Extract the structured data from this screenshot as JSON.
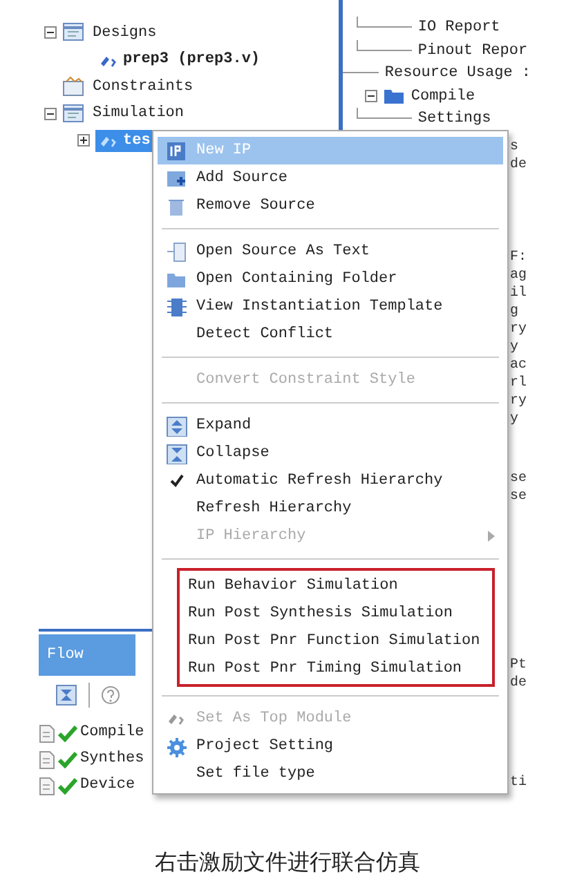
{
  "left_tree": [
    {
      "label": "Designs",
      "expandable": true,
      "expanded": true,
      "children": [
        {
          "label": "prep3 (prep3.v)",
          "expandable": false,
          "selected": false
        }
      ],
      "selected": false
    },
    {
      "label": "Constraints",
      "expandable": false,
      "selected": false
    },
    {
      "label": "Simulation",
      "expandable": true,
      "expanded": true,
      "children": [
        {
          "label": "tes",
          "expandable": true,
          "expanded": false,
          "selected": true
        }
      ],
      "selected": false
    }
  ],
  "right_tree": [
    {
      "label": "IO Report",
      "kind": "leaf"
    },
    {
      "label": "Pinout Repor",
      "kind": "leaf"
    },
    {
      "label": "Resource Usage :",
      "kind": "plain"
    },
    {
      "label": "Compile",
      "kind": "folder"
    },
    {
      "label": "Settings",
      "kind": "leaf"
    }
  ],
  "right_fragments": [
    [
      "s",
      "de"
    ],
    [
      "F:",
      "ag",
      "il",
      "g",
      "ry",
      "y",
      "ac",
      "rl",
      "ry",
      "y"
    ],
    [
      "se",
      "se"
    ],
    [
      "Pt",
      "de"
    ],
    [
      "ti"
    ]
  ],
  "flow": {
    "tab": {
      "label": "Flow",
      "selected": true
    },
    "rows": [
      {
        "label": "Compile",
        "done": true
      },
      {
        "label": "Synthes",
        "done": true
      },
      {
        "label": "Device",
        "done": true
      }
    ]
  },
  "menu": {
    "sections": [
      {
        "outlined": false,
        "items": [
          {
            "label": "New IP",
            "selected": true,
            "disabled": false,
            "checked": false,
            "submenu": false
          },
          {
            "label": "Add Source",
            "selected": false,
            "disabled": false,
            "checked": false,
            "submenu": false
          },
          {
            "label": "Remove Source",
            "selected": false,
            "disabled": false,
            "checked": false,
            "submenu": false
          }
        ]
      },
      {
        "outlined": false,
        "items": [
          {
            "label": "Open Source As Text",
            "selected": false,
            "disabled": false,
            "checked": false,
            "submenu": false
          },
          {
            "label": "Open Containing Folder",
            "selected": false,
            "disabled": false,
            "checked": false,
            "submenu": false
          },
          {
            "label": "View Instantiation Template",
            "selected": false,
            "disabled": false,
            "checked": false,
            "submenu": false
          },
          {
            "label": "Detect Conflict",
            "selected": false,
            "disabled": false,
            "checked": false,
            "submenu": false
          }
        ]
      },
      {
        "outlined": false,
        "items": [
          {
            "label": "Convert Constraint Style",
            "selected": false,
            "disabled": true,
            "checked": false,
            "submenu": false
          }
        ]
      },
      {
        "outlined": false,
        "items": [
          {
            "label": "Expand",
            "selected": false,
            "disabled": false,
            "checked": false,
            "submenu": false
          },
          {
            "label": "Collapse",
            "selected": false,
            "disabled": false,
            "checked": false,
            "submenu": false
          },
          {
            "label": "Automatic Refresh Hierarchy",
            "selected": false,
            "disabled": false,
            "checked": true,
            "submenu": false
          },
          {
            "label": "Refresh Hierarchy",
            "selected": false,
            "disabled": false,
            "checked": false,
            "submenu": false
          },
          {
            "label": "IP Hierarchy",
            "selected": false,
            "disabled": true,
            "checked": false,
            "submenu": true
          }
        ]
      },
      {
        "outlined": true,
        "items": [
          {
            "label": "Run Behavior Simulation",
            "selected": false,
            "disabled": false,
            "checked": false,
            "submenu": false
          },
          {
            "label": "Run Post Synthesis Simulation",
            "selected": false,
            "disabled": false,
            "checked": false,
            "submenu": false
          },
          {
            "label": "Run Post Pnr Function Simulation",
            "selected": false,
            "disabled": false,
            "checked": false,
            "submenu": false
          },
          {
            "label": "Run Post Pnr Timing Simulation",
            "selected": false,
            "disabled": false,
            "checked": false,
            "submenu": false
          }
        ]
      },
      {
        "outlined": false,
        "items": [
          {
            "label": "Set As Top Module",
            "selected": false,
            "disabled": true,
            "checked": false,
            "submenu": false
          },
          {
            "label": "Project Setting",
            "selected": false,
            "disabled": false,
            "checked": false,
            "submenu": false
          },
          {
            "label": "Set file type",
            "selected": false,
            "disabled": false,
            "checked": false,
            "submenu": false
          }
        ]
      }
    ]
  },
  "caption": "右击激励文件进行联合仿真"
}
